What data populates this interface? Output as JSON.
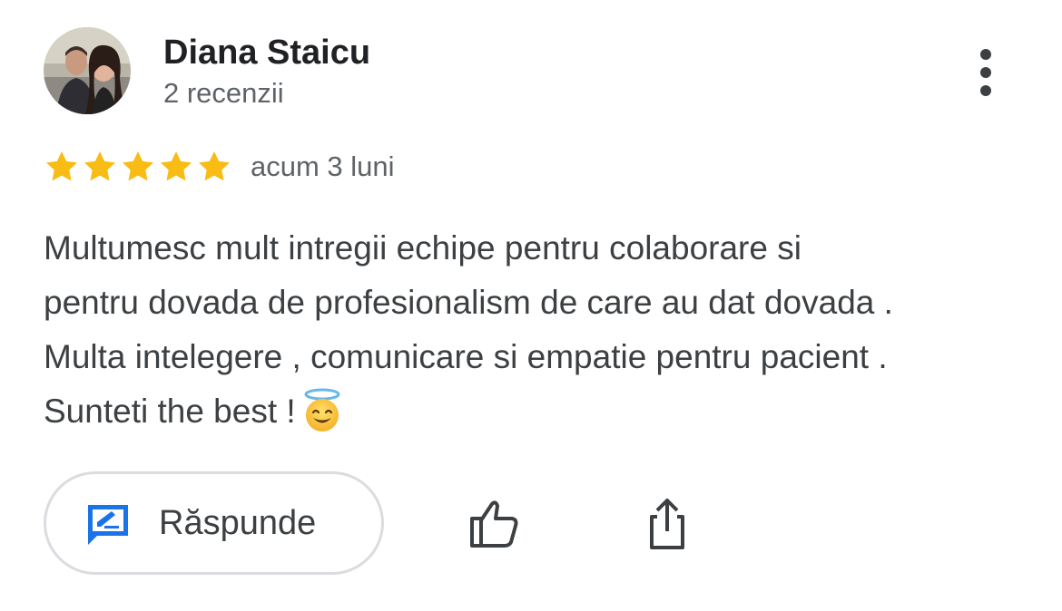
{
  "reviewer": {
    "name": "Diana Staicu",
    "review_count": "2 recenzii"
  },
  "rating": {
    "stars": 5,
    "max": 5,
    "date": "acum 3 luni"
  },
  "review": {
    "lines": [
      "Multumesc mult intregii echipe pentru colaborare si",
      "pentru dovada de profesionalism de care au dat dovada .",
      "Multa intelegere , comunicare si empatie pentru pacient .",
      "Sunteti the best !"
    ],
    "emoji": "smiling-face-with-halo"
  },
  "actions": {
    "reply_label": "Răspunde",
    "like_icon": "thumbs-up-icon",
    "share_icon": "share-icon",
    "more_icon": "more-vert-icon"
  },
  "colors": {
    "star": "#F9BC15",
    "reply_icon": "#1A73E8",
    "text": "#3C4043",
    "secondary": "#5F6368",
    "border": "#DADCE0"
  }
}
